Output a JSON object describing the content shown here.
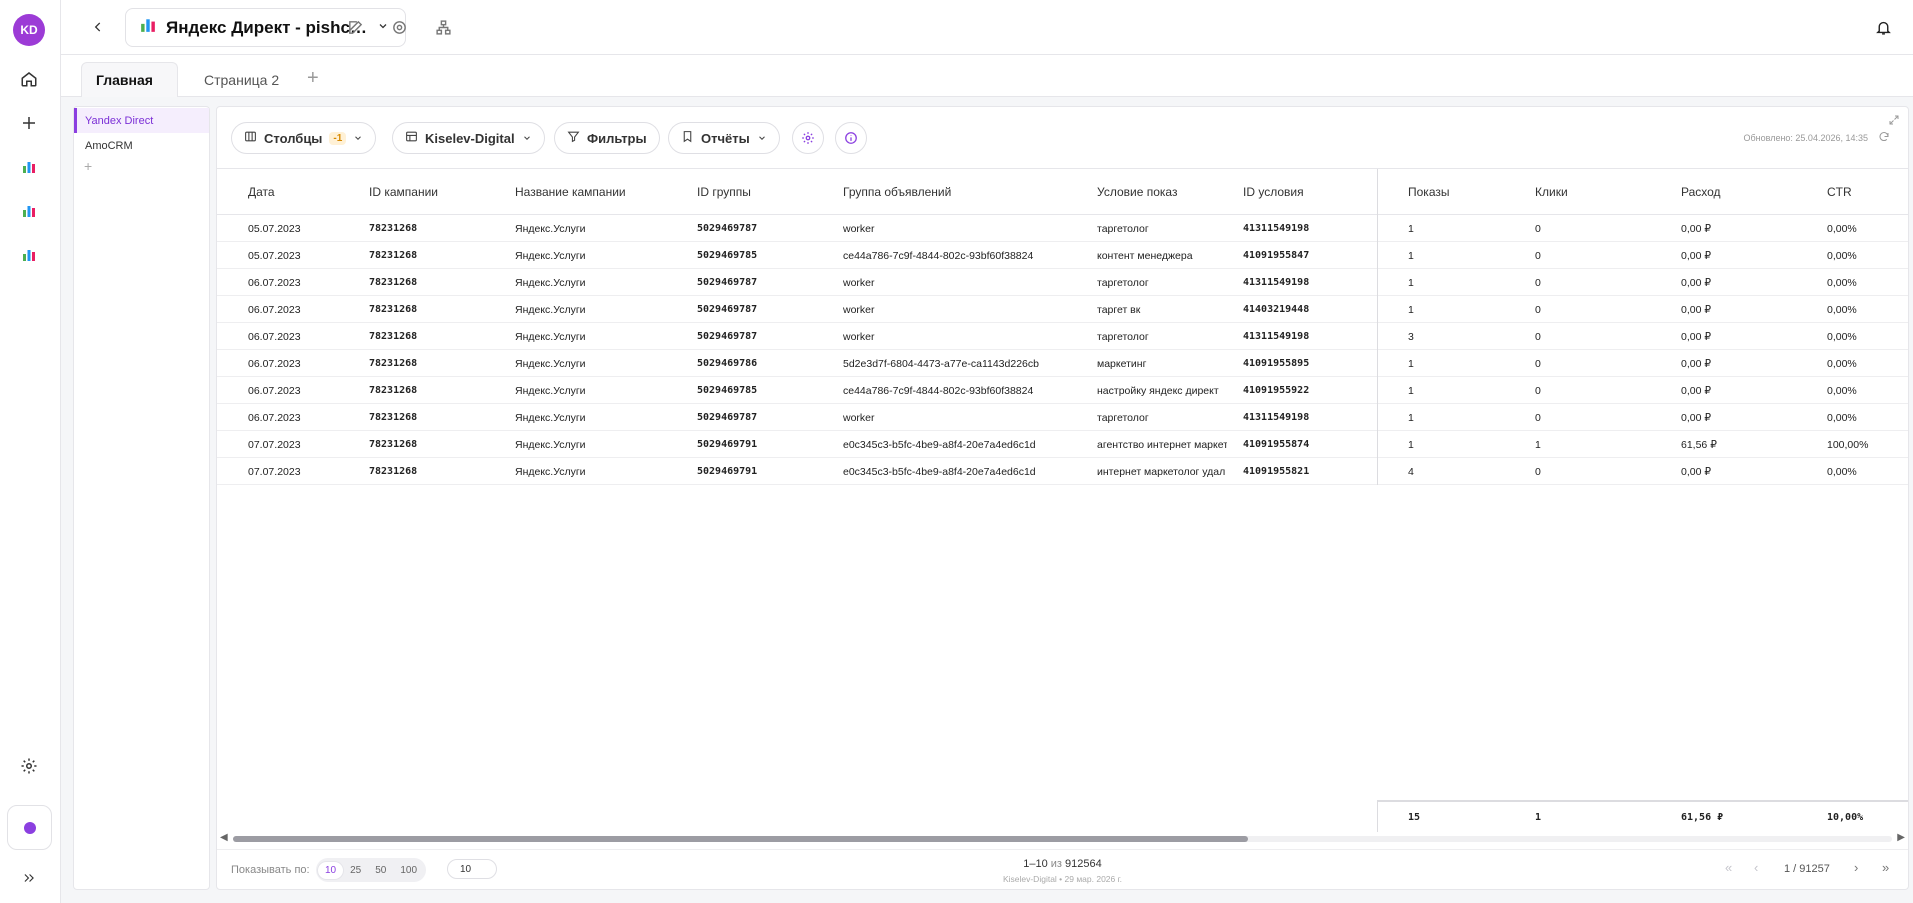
{
  "rail": {
    "avatar": "KD"
  },
  "header": {
    "title": "Яндекс Директ - pishchik..."
  },
  "tabs": [
    {
      "label": "Главная",
      "active": true
    },
    {
      "label": "Страница 2",
      "active": false
    }
  ],
  "sources": [
    {
      "label": "Yandex Direct",
      "active": true
    },
    {
      "label": "AmoCRM",
      "active": false
    }
  ],
  "toolbar": {
    "columns_label": "Столбцы",
    "columns_badge": "-1",
    "account_label": "Kiselev-Digital",
    "filters_label": "Фильтры",
    "reports_label": "Отчёты",
    "updated": "Обновлено: 25.04.2026, 14:35"
  },
  "table": {
    "columns": [
      "Дата",
      "ID кампании",
      "Название кампании",
      "ID группы",
      "Группа объявлений",
      "Условие показ",
      "ID условия",
      "Показы",
      "Клики",
      "Расход",
      "CTR"
    ],
    "rows": [
      [
        "05.07.2023",
        "78231268",
        "Яндекс.Услуги",
        "5029469787",
        "worker",
        "таргетолог",
        "41311549198",
        "1",
        "0",
        "0,00 ₽",
        "0,00%"
      ],
      [
        "05.07.2023",
        "78231268",
        "Яндекс.Услуги",
        "5029469785",
        "ce44a786-7c9f-4844-802c-93bf60f38824",
        "контент менеджера",
        "41091955847",
        "1",
        "0",
        "0,00 ₽",
        "0,00%"
      ],
      [
        "06.07.2023",
        "78231268",
        "Яндекс.Услуги",
        "5029469787",
        "worker",
        "таргетолог",
        "41311549198",
        "1",
        "0",
        "0,00 ₽",
        "0,00%"
      ],
      [
        "06.07.2023",
        "78231268",
        "Яндекс.Услуги",
        "5029469787",
        "worker",
        "таргет вк",
        "41403219448",
        "1",
        "0",
        "0,00 ₽",
        "0,00%"
      ],
      [
        "06.07.2023",
        "78231268",
        "Яндекс.Услуги",
        "5029469787",
        "worker",
        "таргетолог",
        "41311549198",
        "3",
        "0",
        "0,00 ₽",
        "0,00%"
      ],
      [
        "06.07.2023",
        "78231268",
        "Яндекс.Услуги",
        "5029469786",
        "5d2e3d7f-6804-4473-a77e-ca1143d226cb",
        "маркетинг",
        "41091955895",
        "1",
        "0",
        "0,00 ₽",
        "0,00%"
      ],
      [
        "06.07.2023",
        "78231268",
        "Яндекс.Услуги",
        "5029469785",
        "ce44a786-7c9f-4844-802c-93bf60f38824",
        "настройку яндекс директ",
        "41091955922",
        "1",
        "0",
        "0,00 ₽",
        "0,00%"
      ],
      [
        "06.07.2023",
        "78231268",
        "Яндекс.Услуги",
        "5029469787",
        "worker",
        "таргетолог",
        "41311549198",
        "1",
        "0",
        "0,00 ₽",
        "0,00%"
      ],
      [
        "07.07.2023",
        "78231268",
        "Яндекс.Услуги",
        "5029469791",
        "e0c345c3-b5fc-4be9-a8f4-20e7a4ed6c1d",
        "агентство интернет маркет",
        "41091955874",
        "1",
        "1",
        "61,56 ₽",
        "100,00%"
      ],
      [
        "07.07.2023",
        "78231268",
        "Яндекс.Услуги",
        "5029469791",
        "e0c345c3-b5fc-4be9-a8f4-20e7a4ed6c1d",
        "интернет маркетолог удал",
        "41091955821",
        "4",
        "0",
        "0,00 ₽",
        "0,00%"
      ]
    ],
    "totals": [
      "15",
      "1",
      "61,56 ₽",
      "10,00%"
    ]
  },
  "footer": {
    "per_page_label": "Показывать по:",
    "per_page_options": [
      "10",
      "25",
      "50",
      "100"
    ],
    "per_page_selected": "10",
    "per_page_input": "10",
    "range_prefix": "1–10",
    "range_of": "из",
    "range_total": "912564",
    "sub": "Kiselev-Digital  •  29 мар. 2026 г.",
    "page": "1 / 91257"
  },
  "colors": {
    "accent": "#8b3fe0",
    "avatar": "#9c3bd6"
  }
}
